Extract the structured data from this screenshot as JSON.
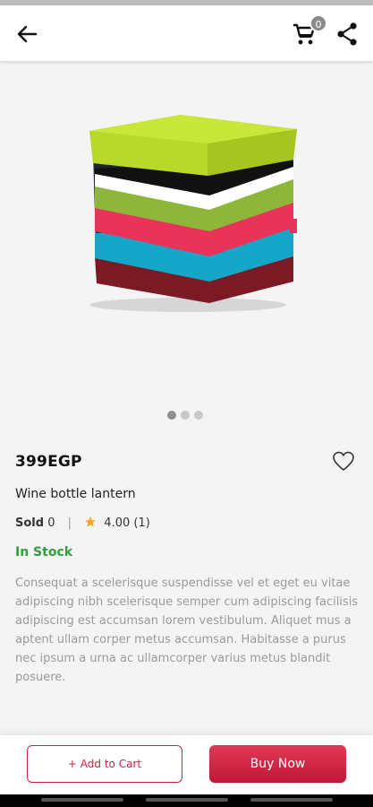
{
  "header": {
    "back_icon": "arrow-left-icon",
    "cart_icon": "cart-icon",
    "cart_count": "0",
    "share_icon": "share-icon"
  },
  "gallery": {
    "image_subject": "striped storage ottoman",
    "dot_count": 3,
    "active_dot": 0
  },
  "product": {
    "price": "399EGP",
    "title": "Wine bottle lantern",
    "sold_label": "Sold",
    "sold_count": "0",
    "separator": "|",
    "rating": "4.00",
    "rating_count": "(1)",
    "stock": "In Stock",
    "description": "Consequat a scelerisque suspendisse vel et eget eu vitae adipiscing nibh scelerisque semper cum adipiscing facilisis adipiscing est accumsan lorem vestibulum. Aliquet mus a aptent ullam corper metus accumsan. Habitasse a purus nec ipsum a urna ac ullamcorper varius metus blandit posuere."
  },
  "actions": {
    "add_to_cart": "+ Add to Cart",
    "buy_now": "Buy Now"
  },
  "colors": {
    "accent": "#d0203f",
    "in_stock": "#2e9e3f",
    "star": "#f5a623"
  }
}
